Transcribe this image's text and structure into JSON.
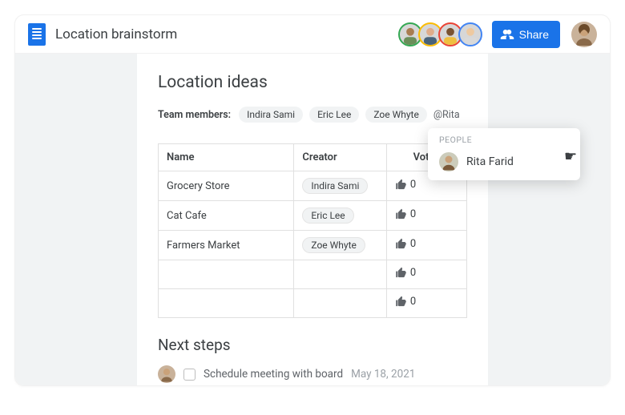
{
  "header": {
    "doc_title": "Location brainstorm",
    "share_label": "Share",
    "collaborator_ring_colors": [
      "#34a853",
      "#fbbc04",
      "#ea4335",
      "#4285f4"
    ]
  },
  "sections": {
    "ideas_title": "Location ideas",
    "next_title": "Next steps"
  },
  "team": {
    "label": "Team members:",
    "members": [
      "Indira Sami",
      "Eric Lee",
      "Zoe Whyte"
    ],
    "mention_in_progress": "@Rita"
  },
  "table": {
    "headers": {
      "name": "Name",
      "creator": "Creator",
      "votes": "Votes"
    },
    "rows": [
      {
        "name": "Grocery Store",
        "creator": "Indira Sami",
        "votes": 0
      },
      {
        "name": "Cat Cafe",
        "creator": "Eric Lee",
        "votes": 0
      },
      {
        "name": "Farmers Market",
        "creator": "Zoe Whyte",
        "votes": 0
      },
      {
        "name": "",
        "creator": "",
        "votes": 0
      },
      {
        "name": "",
        "creator": "",
        "votes": 0
      }
    ]
  },
  "task": {
    "text": "Schedule meeting with board",
    "date": "May 18, 2021"
  },
  "people_popover": {
    "label": "PEOPLE",
    "suggestion": "Rita Farid"
  }
}
